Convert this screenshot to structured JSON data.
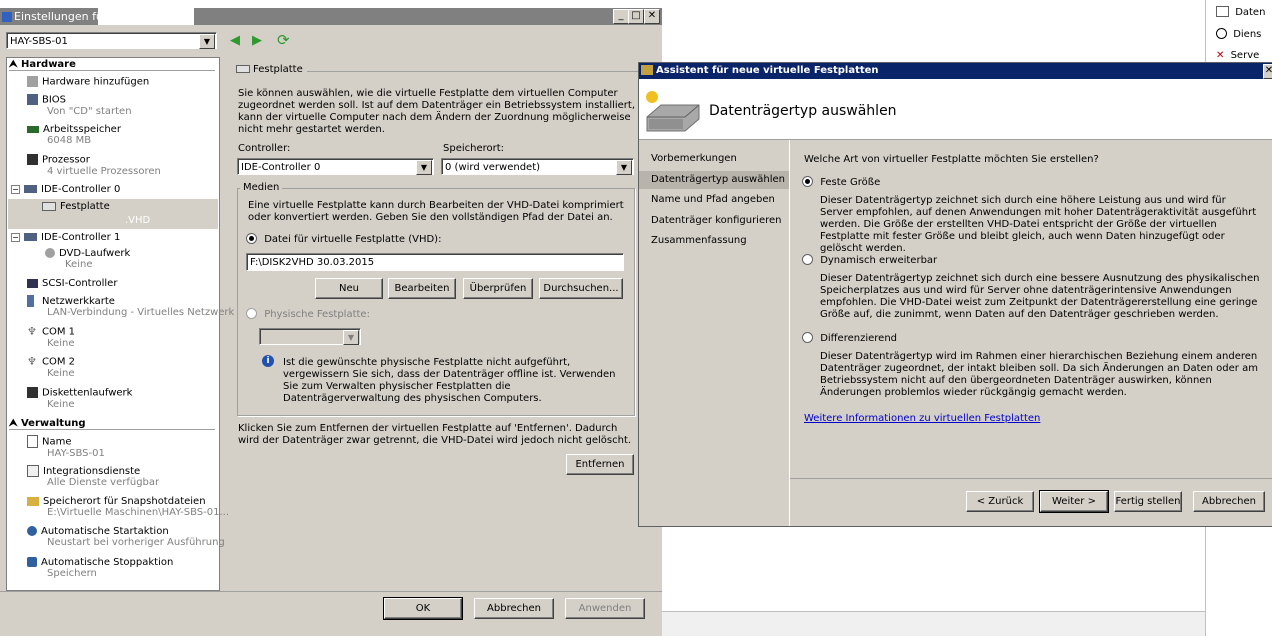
{
  "main_window": {
    "title": "Einstellungen fü",
    "vm_name": "HAY-SBS-01",
    "tree": {
      "hardware_header": "Hardware",
      "items": [
        {
          "label": "Hardware hinzufügen",
          "sub": ""
        },
        {
          "label": "BIOS",
          "sub": "Von \"CD\" starten"
        },
        {
          "label": "Arbeitsspeicher",
          "sub": "6048 MB"
        },
        {
          "label": "Prozessor",
          "sub": "4 virtuelle Prozessoren"
        },
        {
          "label": "IDE-Controller 0",
          "sub": ""
        },
        {
          "label": "Festplatte",
          "sub": ".VHD"
        },
        {
          "label": "IDE-Controller 1",
          "sub": ""
        },
        {
          "label": "DVD-Laufwerk",
          "sub": "Keine"
        },
        {
          "label": "SCSI-Controller",
          "sub": ""
        },
        {
          "label": "Netzwerkkarte",
          "sub": "LAN-Verbindung - Virtuelles Netzwerk"
        },
        {
          "label": "COM 1",
          "sub": "Keine"
        },
        {
          "label": "COM 2",
          "sub": "Keine"
        },
        {
          "label": "Diskettenlaufwerk",
          "sub": "Keine"
        }
      ],
      "management_header": "Verwaltung",
      "mgmt_items": [
        {
          "label": "Name",
          "sub": "HAY-SBS-01"
        },
        {
          "label": "Integrationsdienste",
          "sub": "Alle Dienste verfügbar"
        },
        {
          "label": "Speicherort für Snapshotdateien",
          "sub": "E:\\Virtuelle Maschinen\\HAY-SBS-01..."
        },
        {
          "label": "Automatische Startaktion",
          "sub": "Neustart bei vorheriger Ausführung"
        },
        {
          "label": "Automatische Stoppaktion",
          "sub": "Speichern"
        }
      ]
    },
    "panel": {
      "title": "Festplatte",
      "intro": "Sie können auswählen, wie die virtuelle Festplatte dem virtuellen Computer zugeordnet werden soll. Ist auf dem Datenträger ein Betriebssystem installiert, kann der virtuelle Computer nach dem Ändern der Zuordnung möglicherweise nicht mehr gestartet werden.",
      "controller_label": "Controller:",
      "controller_value": "IDE-Controller 0",
      "location_label": "Speicherort:",
      "location_value": "0 (wird verwendet)",
      "media_label": "Medien",
      "media_text": "Eine virtuelle Festplatte kann durch Bearbeiten der VHD-Datei komprimiert oder konvertiert werden. Geben Sie den vollständigen Pfad der Datei an.",
      "vhd_radio": "Datei für virtuelle Festplatte (VHD):",
      "vhd_path": "F:\\DISK2VHD 30.03.2015",
      "btn_new": "Neu",
      "btn_edit": "Bearbeiten",
      "btn_check": "Überprüfen",
      "btn_browse": "Durchsuchen...",
      "physical_radio": "Physische Festplatte:",
      "info_text": "Ist die gewünschte physische Festplatte nicht aufgeführt, vergewissern Sie sich, dass der Datenträger offline ist. Verwenden Sie zum Verwalten physischer Festplatten die Datenträgerverwaltung des physischen Computers.",
      "remove_text": "Klicken Sie zum Entfernen der virtuellen Festplatte auf 'Entfernen'. Dadurch wird der Datenträger zwar getrennt, die VHD-Datei wird jedoch nicht gelöscht.",
      "btn_remove": "Entfernen"
    },
    "footer": {
      "ok": "OK",
      "cancel": "Abbrechen",
      "apply": "Anwenden"
    }
  },
  "wizard": {
    "title": "Assistent für neue virtuelle Festplatten",
    "header": "Datenträgertyp auswählen",
    "nav": [
      "Vorbemerkungen",
      "Datenträgertyp auswählen",
      "Name und Pfad angeben",
      "Datenträger konfigurieren",
      "Zusammenfassung"
    ],
    "question": "Welche Art von virtueller Festplatte möchten Sie erstellen?",
    "options": [
      {
        "label": "Feste Größe",
        "desc": "Dieser Datenträgertyp zeichnet sich durch eine höhere Leistung aus und wird für Server empfohlen, auf denen Anwendungen mit hoher Datenträgeraktivität ausgeführt werden. Die Größe der erstellten VHD-Datei entspricht der Größe der virtuellen Festplatte mit fester Größe und bleibt gleich, auch wenn Daten hinzugefügt oder gelöscht werden."
      },
      {
        "label": "Dynamisch erweiterbar",
        "desc": "Dieser Datenträgertyp zeichnet sich durch eine bessere Ausnutzung des physikalischen Speicherplatzes aus und wird für Server ohne datenträgerintensive Anwendungen empfohlen. Die VHD-Datei weist zum Zeitpunkt der Datenträgererstellung eine geringe Größe auf, die zunimmt, wenn Daten auf den Datenträger geschrieben werden."
      },
      {
        "label": "Differenzierend",
        "desc": "Dieser Datenträgertyp wird im Rahmen einer hierarchischen Beziehung einem anderen Datenträger zugeordnet, der intakt bleiben soll. Da sich Änderungen an Daten oder am Betriebssystem nicht auf den übergeordneten Datenträger auswirken, können Änderungen problemlos wieder rückgängig gemacht werden."
      }
    ],
    "more_link": "Weitere Informationen zu virtuellen Festplatten",
    "btn_back": "< Zurück",
    "btn_next": "Weiter >",
    "btn_finish": "Fertig stellen",
    "btn_cancel": "Abbrechen"
  },
  "bg_actions": [
    "Daten",
    "Diens",
    "Serve"
  ]
}
